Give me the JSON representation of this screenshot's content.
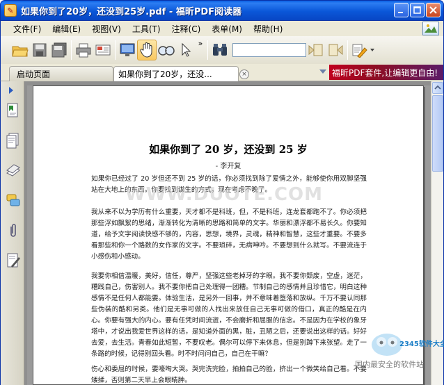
{
  "window": {
    "title": "如果你到了20岁，还没到25岁.pdf - 福昕PDF阅读器",
    "app_icon_glyph": "✎"
  },
  "menu": {
    "items": [
      "文件(F)",
      "编辑(E)",
      "视图(V)",
      "工具(T)",
      "注释(C)",
      "表单(M)",
      "帮助(H)"
    ]
  },
  "toolbar": {
    "icons": [
      "open-folder-icon",
      "save-icon",
      "save-all-icon",
      "print-icon",
      "email-icon",
      "fullscreen-icon",
      "hand-tool-icon",
      "zoom-tool-icon",
      "select-tool-icon",
      "find-icon",
      "prev-result-icon",
      "next-result-icon",
      "highlight-icon"
    ],
    "overflow_glyph": "»",
    "search_value": ""
  },
  "tabs": {
    "home_label": "启动页面",
    "doc_label": "如果你到了20岁，还没...",
    "close_glyph": "×",
    "promo_text": "福昕PDF套件,让编辑更自由!"
  },
  "sidebar": {
    "icons": [
      "bookmarks-icon",
      "pages-icon",
      "layers-icon",
      "comments-icon",
      "attachments-icon",
      "signature-icon"
    ]
  },
  "document": {
    "title": "如果你到了 20 岁，还没到  25 岁",
    "author": "- 李开复",
    "paragraphs": [
      "如果你已经过了 20 岁但还不到 25 岁的话，你必须找到除了爱情之外，能够使你用双脚坚强站在大地上的东西。你要找到谋生的方式，现在考虑不晚了。",
      "我从来不以为学历有什么重要，天才都不是科班，但，不是科班，连龙套都跑不了。你必须把那些浮如飘絮的思绪，渐渐转化为清晰的思路和简单的文字。华丽和漂浮都不易长久。你要知道，给予文字阅读快感不够的，内容，思想，境界，灵魂，精神和智慧，这些才重要。不要多看那些和你一个路数的女作家的文字。不要琐碎，无病呻吟。不要想到什么就写。不要流连于小感伤和小感动。",
      "我要你相信温暖，美好，信任，尊严，坚强这些老掉牙的字眼。我不要你颓废，空虚，迷茫，糟践自己，伤害别人。我不要你把自己处理得一团糟。节制自己的感情并且珍惜它，明白这种感情不是任何人都能要。体验生活，是另外一回事，并不意味着堕落和放纵。千万不要认同那些伪装的酷和另类。他们是无事可做的人找出来放任自己无事可做的借口，真正的酷是在内心。你要有强大的内心。要有任凭时间流逝，不会磨折和屈服的信念。不是因为在学校的象牙塔中，才说出我爱世界这样的话，是知道外面的黑，脏，丑陋之后，还要说出这样的话。好好去爱，去生活。青春如此短暂，不要叹老。偶尔可以停下来休息，但是别蹲下来张望。走了一条路的时候，记得别回头看。时不时问问自己，自己在干嘛？",
      "伤心和委屈的时候，要嚎啕大哭。哭完洗完脸，拍拍自己的脸，挤出一个微笑给自己看。不要矮揉，否则第二天早上会眼睛肿。"
    ]
  },
  "overlays": {
    "watermark": "WWW.DUOTE.COM",
    "corner_brand": "2345软件大全",
    "corner_slogan": "国内最安全的软件站"
  },
  "colors": {
    "titlebar": "#0a57d8",
    "promo": "#c0001f",
    "hand_tool_active": "#f9c860"
  }
}
